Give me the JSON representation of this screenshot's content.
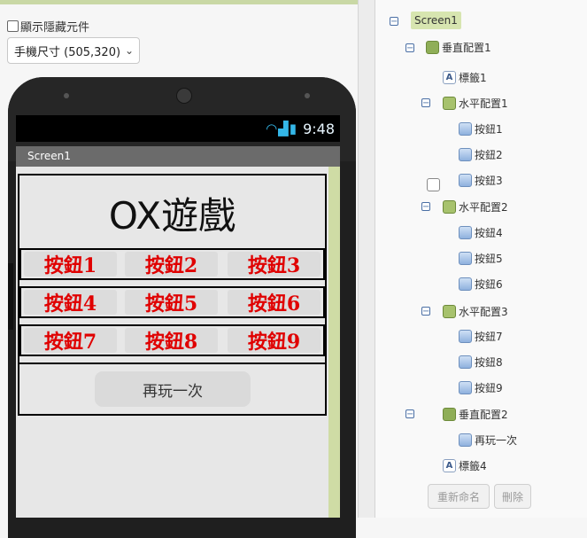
{
  "viewer": {
    "hidden_checkbox_label": "顯示隱藏元件",
    "size_select": "手機尺寸 (505,320)"
  },
  "phone": {
    "status_time": "9:48",
    "screen_title": "Screen1"
  },
  "app": {
    "title_label": "OX遊戲",
    "rows": [
      [
        "按鈕1",
        "按鈕2",
        "按鈕3"
      ],
      [
        "按鈕4",
        "按鈕5",
        "按鈕6"
      ],
      [
        "按鈕7",
        "按鈕8",
        "按鈕9"
      ]
    ],
    "play_again": "再玩一次"
  },
  "tree": {
    "screen": "Screen1",
    "vert1": "垂直配置1",
    "label1": "標籤1",
    "horz1": "水平配置1",
    "b1": "按鈕1",
    "b2": "按鈕2",
    "b3": "按鈕3",
    "horz2": "水平配置2",
    "b4": "按鈕4",
    "b5": "按鈕5",
    "b6": "按鈕6",
    "horz3": "水平配置3",
    "b7": "按鈕7",
    "b8": "按鈕8",
    "b9": "按鈕9",
    "vert2": "垂直配置2",
    "again": "再玩一次",
    "label4": "標籤4"
  },
  "actions": {
    "rename": "重新命名",
    "delete": "刪除"
  }
}
